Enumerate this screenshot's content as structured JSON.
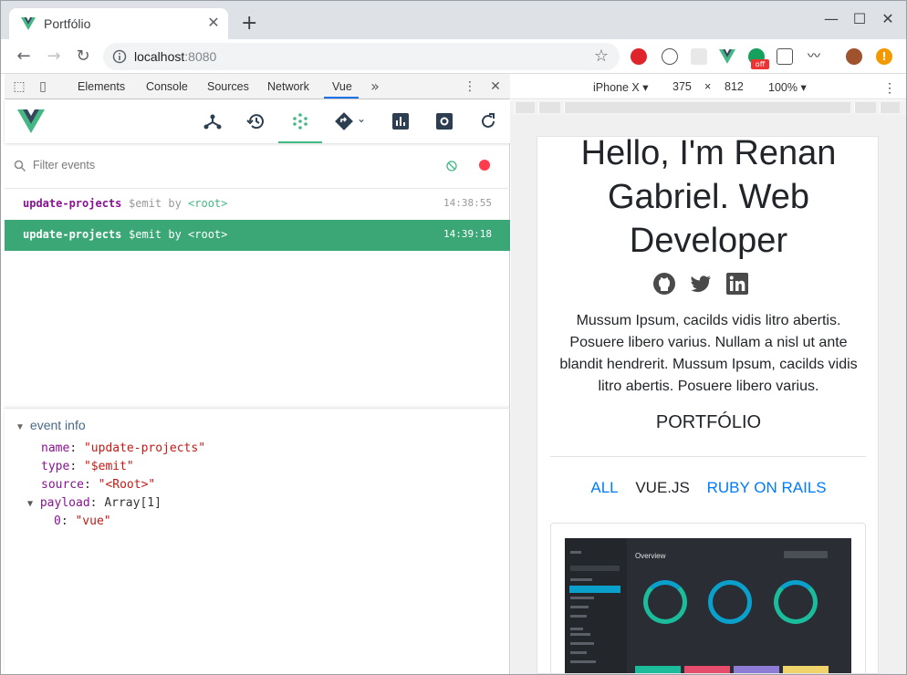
{
  "browser": {
    "tab_title": "Portfólio",
    "url_host": "localhost",
    "url_port": ":8080"
  },
  "devtools": {
    "tabs": [
      "Elements",
      "Console",
      "Sources",
      "Network",
      "Vue"
    ],
    "active_tab": "Vue",
    "filter_placeholder": "Filter events",
    "events": [
      {
        "name": "update-projects",
        "kind": "$emit by",
        "target": "<root>",
        "time": "14:38:55",
        "selected": false
      },
      {
        "name": "update-projects",
        "kind": "$emit by",
        "target": "<root>",
        "time": "14:39:18",
        "selected": true
      }
    ],
    "info": {
      "heading": "event info",
      "name_key": "name",
      "name_val": "\"update-projects\"",
      "type_key": "type",
      "type_val": "\"$emit\"",
      "source_key": "source",
      "source_val": "\"<Root>\"",
      "payload_key": "payload",
      "payload_val": "Array[1]",
      "item_key": "0",
      "item_val": "\"vue\""
    }
  },
  "device": {
    "model": "iPhone X",
    "width": "375",
    "times": "×",
    "height": "812",
    "zoom": "100%"
  },
  "page": {
    "hero_line1": "Hello, I'm Renan",
    "hero_line2": "Gabriel. Web",
    "hero_line3": "Developer",
    "bio": "Mussum Ipsum, cacilds vidis litro abertis. Posuere libero varius. Nullam a nisl ut ante blandit hendrerit. Mussum Ipsum, cacilds vidis litro abertis. Posuere libero varius.",
    "portfolio_title": "PORTFÓLIO",
    "filters": [
      "ALL",
      "VUE.JS",
      "RUBY ON RAILS"
    ],
    "active_filter": "VUE.JS",
    "card_title": "Overview"
  },
  "colors": {
    "vue_green": "#42b983",
    "selected_row": "#3ba776",
    "link_blue": "#007bff",
    "record_red": "#ff3b4d"
  },
  "icons": [
    "github-icon",
    "twitter-icon",
    "linkedin-icon",
    "components-icon",
    "history-icon",
    "events-icon",
    "routing-icon",
    "performance-icon",
    "settings-icon",
    "refresh-icon"
  ]
}
